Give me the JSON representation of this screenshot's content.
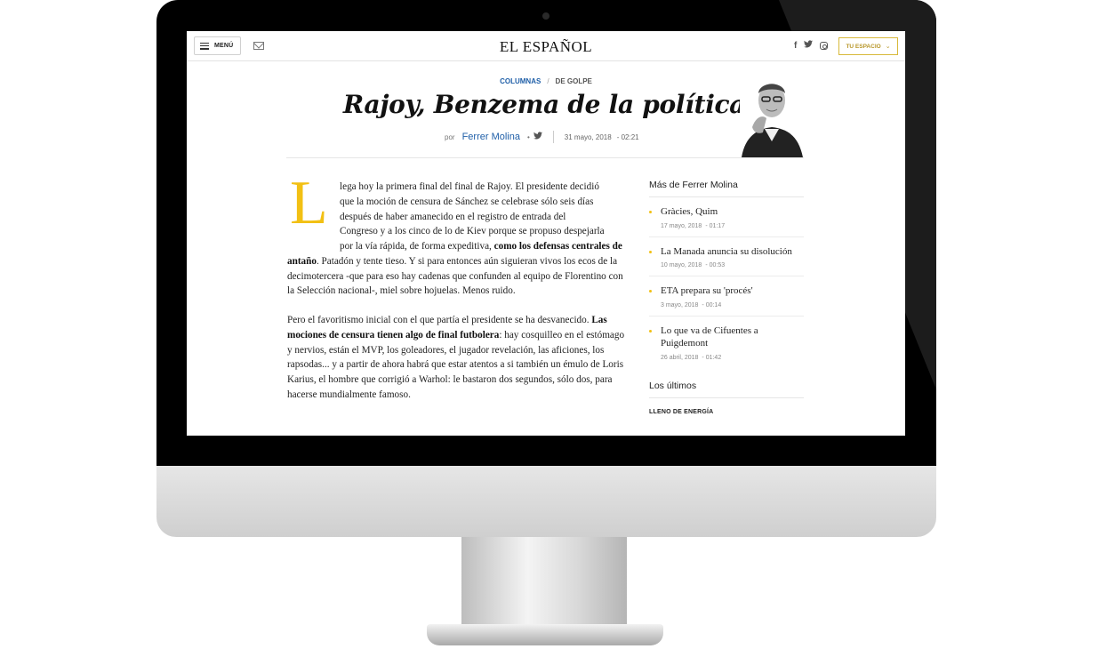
{
  "header": {
    "menu_label": "MENÚ",
    "logo": "EL ESPAÑOL",
    "tu_espacio": "TU ESPACIO"
  },
  "article": {
    "section": "COLUMNAS",
    "separator": "/",
    "subsection": "DE GOLPE",
    "title": "Rajoy, Benzema de la política",
    "by": "por",
    "author": "Ferrer Molina",
    "bullet": "•",
    "date": "31 mayo, 2018",
    "time": "- 02:21",
    "dropcap": "L",
    "p1_lines": [
      "lega hoy la primera final del final de Rajoy. El presidente decidió",
      "que la moción de censura de Sánchez se celebrase sólo seis días",
      "después de haber amanecido en el registro de entrada del",
      "Congreso y a los cinco de lo de Kiev porque se propuso despejarla"
    ],
    "p1_line5_pre": "por la vía rápida, de forma expeditiva, ",
    "p1_bold": "como los defensas centrales de antaño",
    "p1_rest": ". Patadón y tente tieso. Y si para entonces aún siguieran vivos los ecos de la decimotercera -que para eso hay cadenas que confunden al equipo de Florentino con la Selección nacional-, miel sobre hojuelas. Menos ruido.",
    "p2_pre": "Pero el favoritismo inicial con el que partía el presidente se ha desvanecido. ",
    "p2_bold": "Las mociones de censura tienen algo de final futbolera",
    "p2_rest": ": hay cosquilleo en el estómago y nervios, están el MVP, los goleadores, el jugador revelación, las aficiones, los rapsodas... y a partir de ahora habrá que estar atentos a si también un émulo de Loris Karius, el hombre que corrigió a Warhol: le bastaron dos segundos, sólo dos, para hacerse mundialmente famoso."
  },
  "sidebar": {
    "title": "Más de Ferrer Molina",
    "items": [
      {
        "headline": "Gràcies, Quim",
        "date": "17 mayo, 2018",
        "time": "- 01:17"
      },
      {
        "headline": "La Manada anuncia su disolución",
        "date": "10 mayo, 2018",
        "time": "- 00:53"
      },
      {
        "headline": "ETA prepara su 'procés'",
        "date": "3 mayo, 2018",
        "time": "- 00:14"
      },
      {
        "headline": "Lo que va de Cifuentes a Puigdemont",
        "date": "26 abril, 2018",
        "time": "- 01:42"
      }
    ],
    "latest_title": "Los últimos",
    "latest_label": "LLENO DE ENERGÍA"
  },
  "colors": {
    "accent": "#f2c014",
    "link": "#1f5fa8",
    "gold_border": "#d8b93a"
  },
  "icons": [
    "hamburger-icon",
    "mail-icon",
    "facebook-icon",
    "twitter-icon",
    "instagram-icon",
    "chevron-down-icon"
  ]
}
